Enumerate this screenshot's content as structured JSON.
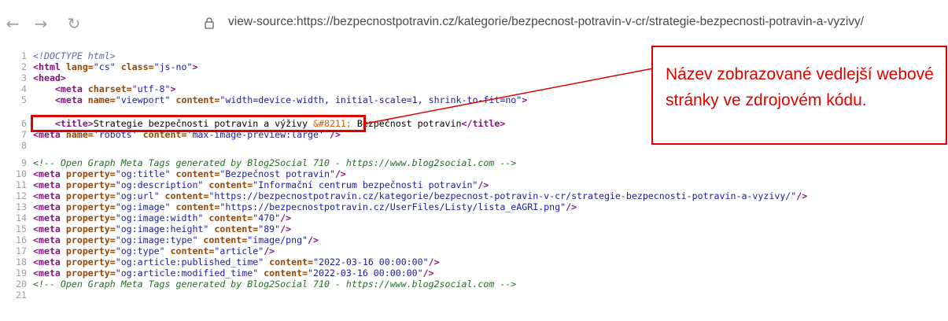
{
  "toolbar": {
    "back_icon": "←",
    "forward_icon": "→",
    "reload_icon": "↻",
    "url": "view-source:https://bezpecnostpotravin.cz/kategorie/bezpecnost-potravin-v-cr/strategie-bezpecnosti-potravin-a-vyzivy/"
  },
  "source": {
    "line_numbers": [
      "1",
      "2",
      "3",
      "4",
      "5",
      "6",
      "7",
      "8",
      "9",
      "10",
      "11",
      "12",
      "13",
      "14",
      "15",
      "16",
      "17",
      "18",
      "19",
      "20",
      "21"
    ],
    "l1_doctype": "<!DOCTYPE html>",
    "l2": {
      "open": "<html",
      "a1": " lang=",
      "v1": "\"cs\"",
      "a2": " class=",
      "v2": "\"js-no\"",
      "close": ">"
    },
    "l3": "<head>",
    "l4": {
      "open": "<meta",
      "a1": " charset=",
      "v1": "\"utf-8\"",
      "close": ">"
    },
    "l5": {
      "open": "<meta",
      "a1": " name=",
      "v1": "\"viewport\"",
      "a2": " content=",
      "v2": "\"width=device-width, initial-scale=1, shrink-to-fit=no\"",
      "close": ">"
    },
    "l6": {
      "open": "<title>",
      "text1": "Strategie bezpečnosti potravin a výživy ",
      "entity": "&#8211;",
      "text2": " Bezpečnost potravin",
      "close": "</title>"
    },
    "l7": {
      "open": "<meta",
      "a1": " name=",
      "v1": "'robots'",
      "a2": " content=",
      "v2": "'max-image-preview:large'",
      "close": " />"
    },
    "l9_comment": "<!-- Open Graph Meta Tags generated by Blog2Social 710 - https://www.blog2social.com -->",
    "og_lines": [
      {
        "prop": "\"og:title\"",
        "content": "\"Bezpečnost potravin\""
      },
      {
        "prop": "\"og:description\"",
        "content": "\"Informační centrum bezpečnosti potravin\""
      },
      {
        "prop": "\"og:url\"",
        "content": "\"https://bezpecnostpotravin.cz/kategorie/bezpecnost-potravin-v-cr/strategie-bezpecnosti-potravin-a-vyzivy/\""
      },
      {
        "prop": "\"og:image\"",
        "content": "\"https://bezpecnostpotravin.cz/UserFiles/Listy/lista_eAGRI.png\""
      },
      {
        "prop": "\"og:image:width\"",
        "content": "\"470\""
      },
      {
        "prop": "\"og:image:height\"",
        "content": "\"89\""
      },
      {
        "prop": "\"og:image:type\"",
        "content": "\"image/png\""
      },
      {
        "prop": "\"og:type\"",
        "content": "\"article\""
      },
      {
        "prop": "\"og:article:published_time\"",
        "content": "\"2022-03-16 00:00:00\""
      },
      {
        "prop": "\"og:article:modified_time\"",
        "content": "\"2022-03-16 00:00:00\""
      }
    ],
    "og_meta_open": "<meta",
    "og_prop_attr": " property=",
    "og_content_attr": " content=",
    "og_close": "/>",
    "l20_comment": "<!-- Open Graph Meta Tags generated by Blog2Social 710 - https://www.blog2social.com -->"
  },
  "annotation": {
    "text": "Název zobrazované vedlejší webové stránky ve zdrojovém kódu.",
    "color": "#e00000"
  }
}
